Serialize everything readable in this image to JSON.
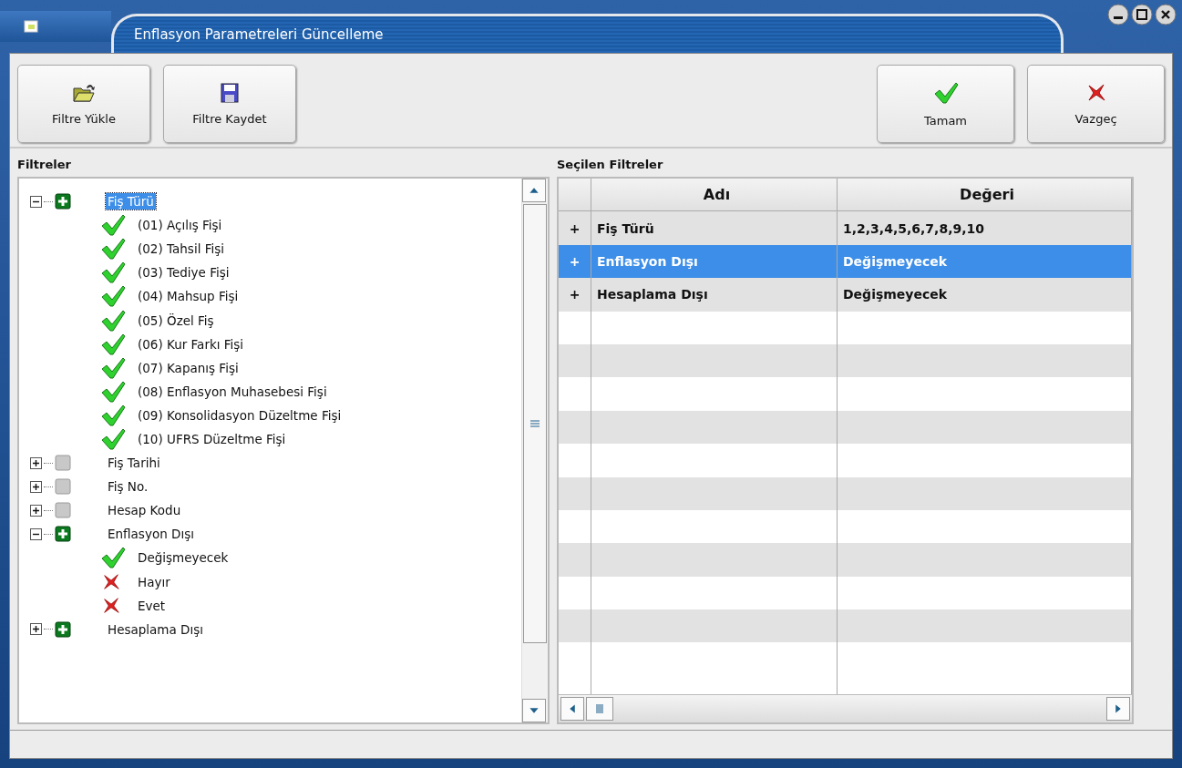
{
  "window": {
    "title": "Enflasyon Parametreleri Güncelleme"
  },
  "toolbar": {
    "left": [
      {
        "kind": "open",
        "label": "Filtre Yükle"
      },
      {
        "kind": "save",
        "label": "Filtre Kaydet"
      }
    ],
    "right": [
      {
        "kind": "ok",
        "label": "Tamam"
      },
      {
        "kind": "cancel",
        "label": "Vazgeç"
      }
    ]
  },
  "filters": {
    "title": "Filtreler",
    "tree": [
      {
        "label": "Fiş Türü",
        "active": true,
        "expanded": true,
        "selected": true,
        "children": [
          {
            "label": "(01) Açılış Fişi",
            "included": true
          },
          {
            "label": "(02) Tahsil Fişi",
            "included": true
          },
          {
            "label": "(03) Tediye Fişi",
            "included": true
          },
          {
            "label": "(04) Mahsup Fişi",
            "included": true
          },
          {
            "label": "(05) Özel Fiş",
            "included": true
          },
          {
            "label": "(06) Kur Farkı Fişi",
            "included": true
          },
          {
            "label": "(07) Kapanış Fişi",
            "included": true
          },
          {
            "label": "(08) Enflasyon Muhasebesi Fişi",
            "included": true
          },
          {
            "label": "(09) Konsolidasyon Düzeltme Fişi",
            "included": true
          },
          {
            "label": "(10) UFRS Düzeltme Fişi",
            "included": true
          }
        ]
      },
      {
        "label": "Fiş Tarihi",
        "active": false,
        "expanded": false,
        "selected": false
      },
      {
        "label": "Fiş No.",
        "active": false,
        "expanded": false,
        "selected": false
      },
      {
        "label": "Hesap Kodu",
        "active": false,
        "expanded": false,
        "selected": false
      },
      {
        "label": "Enflasyon Dışı",
        "active": true,
        "expanded": true,
        "selected": false,
        "children": [
          {
            "label": "Değişmeyecek",
            "included": true
          },
          {
            "label": "Hayır",
            "included": false
          },
          {
            "label": "Evet",
            "included": false
          }
        ]
      },
      {
        "label": "Hesaplama Dışı",
        "active": true,
        "expanded": false,
        "selected": false
      }
    ]
  },
  "selected_filters": {
    "title": "Seçilen Filtreler",
    "columns": [
      "Adı",
      "Değeri"
    ],
    "rows": [
      {
        "marker": "+",
        "name": "Fiş Türü",
        "value": "1,2,3,4,5,6,7,8,9,10",
        "selected": false
      },
      {
        "marker": "+",
        "name": "Enflasyon Dışı",
        "value": "Değişmeyecek",
        "selected": true
      },
      {
        "marker": "+",
        "name": "Hesaplama Dışı",
        "value": "Değişmeyecek",
        "selected": false
      }
    ]
  }
}
